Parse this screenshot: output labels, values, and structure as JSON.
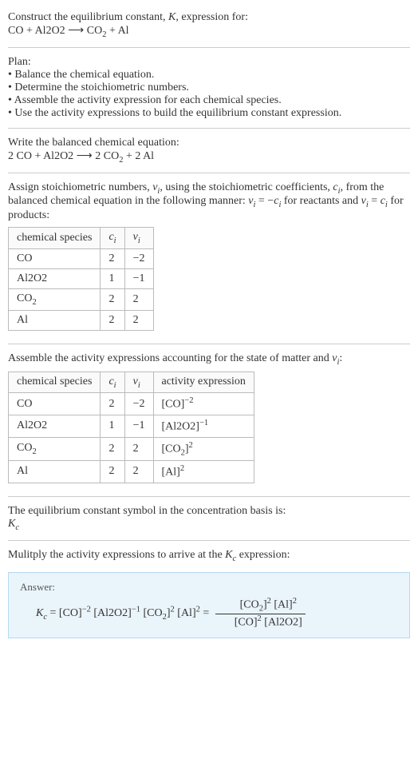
{
  "intro": {
    "line1_prefix": "Construct the equilibrium constant, ",
    "K": "K",
    "line1_suffix": ", expression for:",
    "eq_unbalanced_html": "CO + Al2O2 ⟶ CO<sub>2</sub> + Al"
  },
  "plan": {
    "heading": "Plan:",
    "b1": "• Balance the chemical equation.",
    "b2": "• Determine the stoichiometric numbers.",
    "b3": "• Assemble the activity expression for each chemical species.",
    "b4": "• Use the activity expressions to build the equilibrium constant expression."
  },
  "balanced": {
    "heading": "Write the balanced chemical equation:",
    "eq_html": "2 CO + Al2O2 ⟶ 2 CO<sub>2</sub> + 2 Al"
  },
  "assign": {
    "text_html": "Assign stoichiometric numbers, <span class='ital'>ν<sub>i</sub></span>, using the stoichiometric coefficients, <span class='ital'>c<sub>i</sub></span>, from the balanced chemical equation in the following manner: <span class='ital'>ν<sub>i</sub></span> = −<span class='ital'>c<sub>i</sub></span> for reactants and <span class='ital'>ν<sub>i</sub></span> = <span class='ital'>c<sub>i</sub></span> for products:",
    "table": {
      "headers": {
        "h1": "chemical species",
        "h2_html": "<span class='ital'>c<sub>i</sub></span>",
        "h3_html": "<span class='ital'>ν<sub>i</sub></span>"
      },
      "rows": [
        {
          "species_html": "CO",
          "c": "2",
          "v": "−2"
        },
        {
          "species_html": "Al2O2",
          "c": "1",
          "v": "−1"
        },
        {
          "species_html": "CO<sub>2</sub>",
          "c": "2",
          "v": "2"
        },
        {
          "species_html": "Al",
          "c": "2",
          "v": "2"
        }
      ]
    }
  },
  "activity": {
    "heading_html": "Assemble the activity expressions accounting for the state of matter and <span class='ital'>ν<sub>i</sub></span>:",
    "table": {
      "headers": {
        "h1": "chemical species",
        "h2_html": "<span class='ital'>c<sub>i</sub></span>",
        "h3_html": "<span class='ital'>ν<sub>i</sub></span>",
        "h4": "activity expression"
      },
      "rows": [
        {
          "species_html": "CO",
          "c": "2",
          "v": "−2",
          "act_html": "[CO]<sup>−2</sup>"
        },
        {
          "species_html": "Al2O2",
          "c": "1",
          "v": "−1",
          "act_html": "[Al2O2]<sup>−1</sup>"
        },
        {
          "species_html": "CO<sub>2</sub>",
          "c": "2",
          "v": "2",
          "act_html": "[CO<sub>2</sub>]<sup>2</sup>"
        },
        {
          "species_html": "Al",
          "c": "2",
          "v": "2",
          "act_html": "[Al]<sup>2</sup>"
        }
      ]
    }
  },
  "symbol": {
    "line": "The equilibrium constant symbol in the concentration basis is:",
    "kc_html": "<span class='ital'>K<sub>c</sub></span>"
  },
  "multiply": {
    "line_html": "Mulitply the activity expressions to arrive at the <span class='ital'>K<sub>c</sub></span> expression:"
  },
  "answer": {
    "label": "Answer:",
    "kc_symbol_html": "<span class='ital'>K<sub>c</sub></span> = ",
    "product_html": "[CO]<sup>−2</sup> [Al2O2]<sup>−1</sup> [CO<sub>2</sub>]<sup>2</sup> [Al]<sup>2</sup> = ",
    "frac_top_html": "[CO<sub>2</sub>]<sup>2</sup> [Al]<sup>2</sup>",
    "frac_bot_html": "[CO]<sup>2</sup> [Al2O2]"
  },
  "chart_data": {
    "type": "table",
    "tables": [
      {
        "title": "Stoichiometric numbers",
        "columns": [
          "chemical species",
          "c_i",
          "ν_i"
        ],
        "rows": [
          [
            "CO",
            2,
            -2
          ],
          [
            "Al2O2",
            1,
            -1
          ],
          [
            "CO2",
            2,
            2
          ],
          [
            "Al",
            2,
            2
          ]
        ]
      },
      {
        "title": "Activity expressions",
        "columns": [
          "chemical species",
          "c_i",
          "ν_i",
          "activity expression"
        ],
        "rows": [
          [
            "CO",
            2,
            -2,
            "[CO]^-2"
          ],
          [
            "Al2O2",
            1,
            -1,
            "[Al2O2]^-1"
          ],
          [
            "CO2",
            2,
            2,
            "[CO2]^2"
          ],
          [
            "Al",
            2,
            2,
            "[Al]^2"
          ]
        ]
      }
    ]
  }
}
